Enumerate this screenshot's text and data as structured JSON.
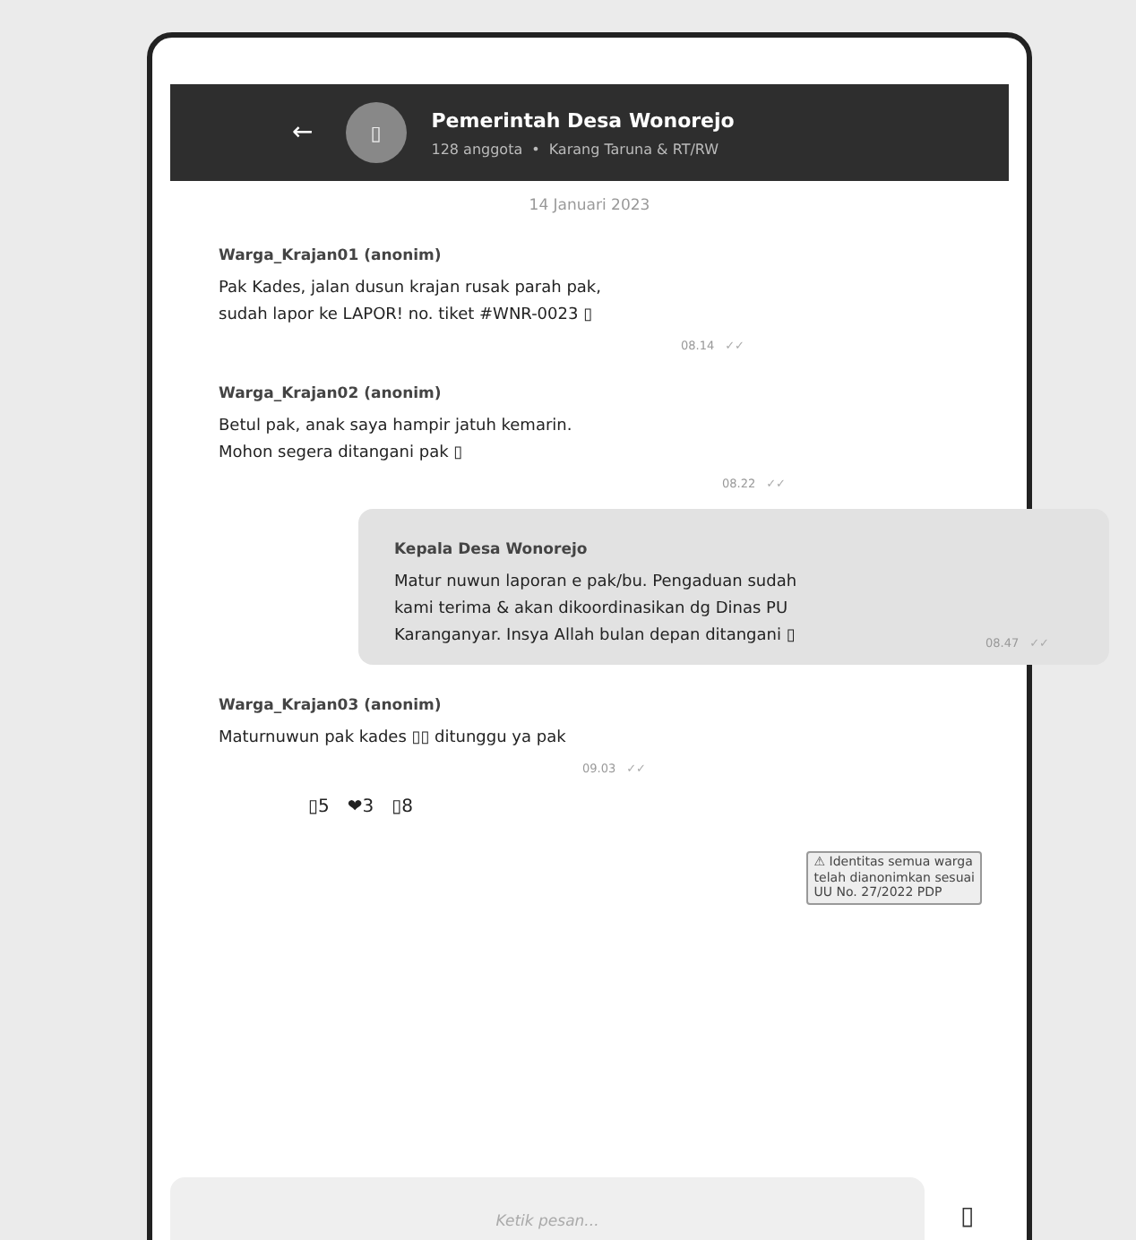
{
  "header": {
    "back": "←",
    "avatar": "▯",
    "title": "Pemerintah Desa Wonorejo",
    "members": "128 anggota",
    "separator": "•",
    "subtitle": "Karang Taruna & RT/RW"
  },
  "date": "14 Januari 2023",
  "messages": [
    {
      "kind": "incoming",
      "sender": "Warga_Krajan01 (anonim)",
      "lines": [
        "Pak Kades, jalan dusun krajan rusak parah pak,",
        "sudah lapor ke LAPOR! no. tiket #WNR-0023 ▯"
      ],
      "time": "08.14",
      "ticks": "✓✓"
    },
    {
      "kind": "incoming",
      "sender": "Warga_Krajan02 (anonim)",
      "lines": [
        "Betul pak, anak saya hampir jatuh kemarin.",
        "Mohon segera ditangani pak ▯"
      ],
      "time": "08.22",
      "ticks": "✓✓"
    },
    {
      "kind": "outgoing",
      "sender": "Kepala Desa Wonorejo",
      "lines": [
        "Matur nuwun laporan e pak/bu. Pengaduan sudah",
        "kami terima & akan dikoordinasikan dg Dinas PU",
        "Karanganyar. Insya Allah bulan depan ditangani ▯"
      ],
      "time": "08.47",
      "ticks": "✓✓"
    },
    {
      "kind": "incoming",
      "sender": "Warga_Krajan03 (anonim)",
      "lines": [
        "Maturnuwun pak kades ▯▯ ditunggu ya pak"
      ],
      "time": "09.03",
      "ticks": "✓✓"
    }
  ],
  "reactions": [
    {
      "emoji": "▯",
      "count": "5"
    },
    {
      "emoji": "❤",
      "count": "3"
    },
    {
      "emoji": "▯",
      "count": "8"
    }
  ],
  "notice": [
    "⚠ Identitas semua warga",
    "telah dianonimkan sesuai",
    "UU No. 27/2022 PDP"
  ],
  "composer": {
    "placeholder": "Ketik pesan...",
    "send": "▯"
  }
}
